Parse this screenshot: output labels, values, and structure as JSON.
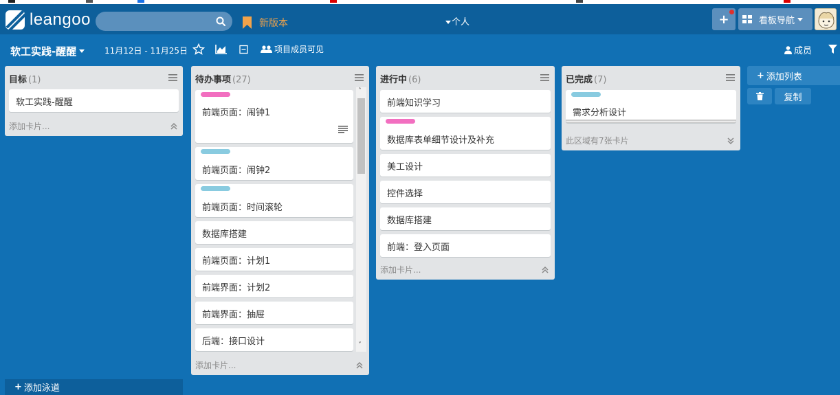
{
  "header": {
    "logo_text": "leangoo",
    "search_placeholder": "",
    "new_version": "新版本",
    "personal": "个人",
    "add_button": "+",
    "board_nav": "看板导航"
  },
  "board": {
    "title": "软工实践-醒醒",
    "date_range": "11月12日 - 11月25日",
    "visibility": "项目成员可见",
    "members": "成员"
  },
  "lists": [
    {
      "title": "目标",
      "count": "(1)",
      "cards": [
        {
          "text": "软工实践-醒醒"
        }
      ],
      "add_card": "添加卡片..."
    },
    {
      "title": "待办事项",
      "count": "(27)",
      "cards": [
        {
          "text": "前端页面：闹钟1",
          "label_color": "#f26fc0"
        },
        {
          "text": "前端页面：闹钟2",
          "label_color": "#89cbe0"
        },
        {
          "text": "前端页面：时间滚轮",
          "label_color": "#89cbe0"
        },
        {
          "text": "数据库搭建"
        },
        {
          "text": "前端页面：计划1"
        },
        {
          "text": "前端界面：计划2"
        },
        {
          "text": "前端界面：抽屉"
        },
        {
          "text": "后端：接口设计"
        }
      ],
      "add_card": "添加卡片..."
    },
    {
      "title": "进行中",
      "count": "(6)",
      "cards": [
        {
          "text": "前端知识学习"
        },
        {
          "text": "数据库表单细节设计及补充",
          "label_color": "#f26fc0"
        },
        {
          "text": "美工设计"
        },
        {
          "text": "控件选择"
        },
        {
          "text": "数据库搭建"
        },
        {
          "text": "前端：登入页面"
        }
      ],
      "add_card": "添加卡片..."
    },
    {
      "title": "已完成",
      "count": "(7)",
      "cards": [
        {
          "text": "需求分析设计",
          "label_color": "#89cbe0"
        }
      ],
      "footer": "此区域有7张卡片"
    }
  ],
  "actions": {
    "add_list": "添加列表",
    "copy": "复制",
    "add_lane": "添加泳道"
  },
  "colors": {
    "background": "#1170b4",
    "header": "#0d5f9b",
    "accent_orange": "#f2a34a",
    "label_pink": "#f26fc0",
    "label_blue": "#89cbe0"
  }
}
